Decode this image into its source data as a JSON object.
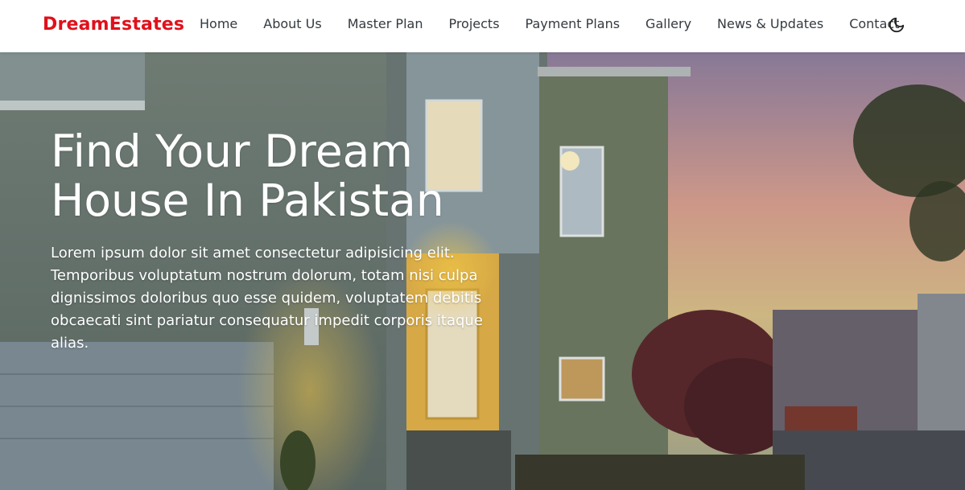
{
  "brand": {
    "name": "DreamEstates",
    "color": "#e0101b"
  },
  "nav": {
    "items": [
      {
        "label": "Home"
      },
      {
        "label": "About Us"
      },
      {
        "label": "Master Plan"
      },
      {
        "label": "Projects"
      },
      {
        "label": "Payment Plans"
      },
      {
        "label": "Gallery"
      },
      {
        "label": "News & Updates"
      },
      {
        "label": "Contact"
      }
    ],
    "theme_toggle_icon": "moon-icon"
  },
  "hero": {
    "title": "Find Your Dream House In Pakistan",
    "description": "Lorem ipsum dolor sit amet consectetur adipisicing elit. Temporibus voluptatum nostrum dolorum, totam nisi culpa dignissimos doloribus quo esse quidem, voluptatem debitis obcaecati sint pariatur consequatur impedit corporis itaque alias.",
    "background": "house-at-dusk-photo"
  }
}
